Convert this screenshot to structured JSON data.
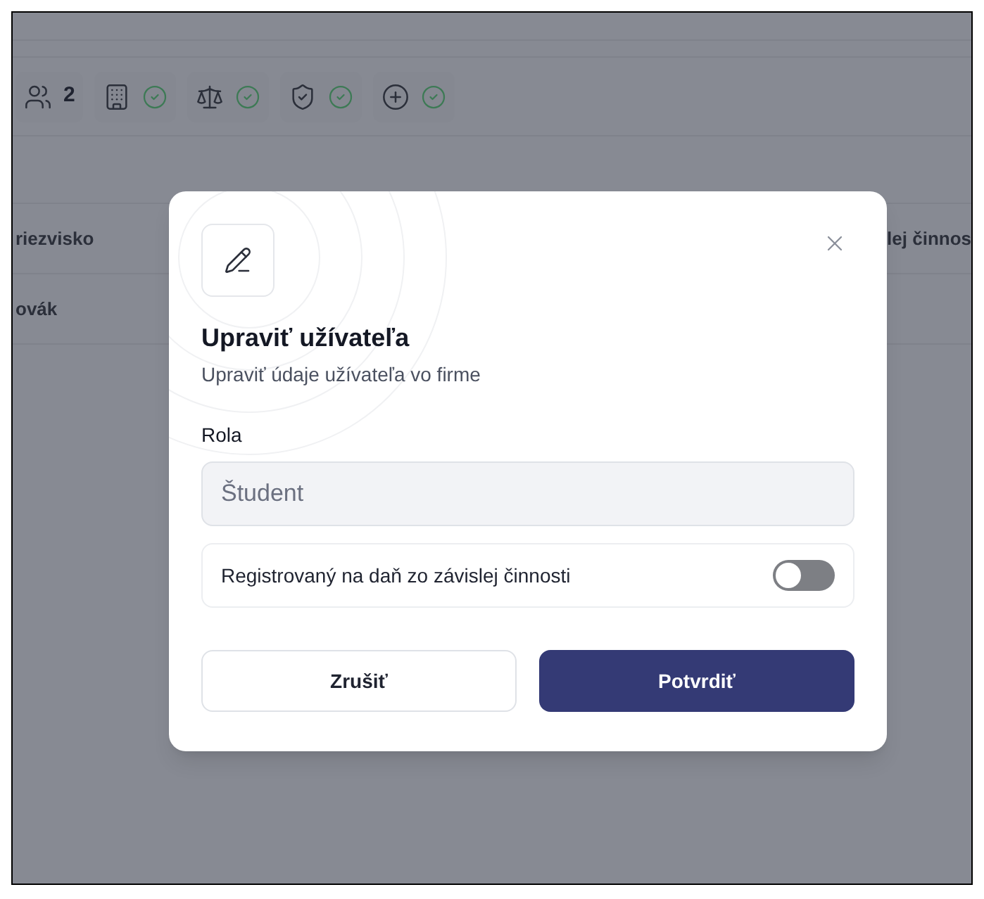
{
  "toolbar": {
    "badges": [
      {
        "kind": "users",
        "count": "2"
      },
      {
        "kind": "building",
        "checked": true
      },
      {
        "kind": "scales",
        "checked": true
      },
      {
        "kind": "shield",
        "checked": true
      },
      {
        "kind": "medical",
        "checked": true
      }
    ]
  },
  "table": {
    "columns": [
      "riezvisko",
      "lej činnos"
    ],
    "rows": [
      [
        "ovák"
      ]
    ]
  },
  "dialog": {
    "title": "Upraviť užívateľa",
    "subtitle": "Upraviť údaje užívateľa vo firme",
    "field": {
      "label": "Rola",
      "value": "Študent",
      "disabled": true
    },
    "toggle": {
      "label": "Registrovaný na daň zo závislej činnosti",
      "on": false
    },
    "buttons": [
      {
        "label": "Zrušiť",
        "kind": "secondary"
      },
      {
        "label": "Potvrdiť",
        "kind": "primary"
      }
    ]
  }
}
